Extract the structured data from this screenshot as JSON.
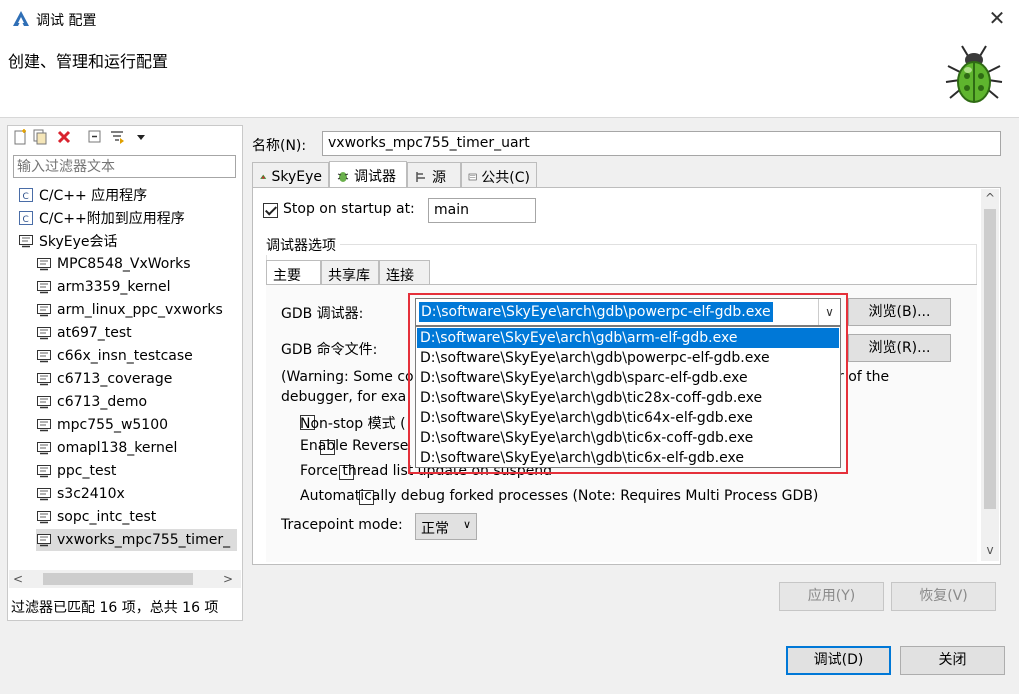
{
  "window": {
    "title": "调试 配置",
    "close_glyph": "✕"
  },
  "banner": {
    "title": "创建、管理和运行配置"
  },
  "left": {
    "filter_placeholder": "输入过滤器文本",
    "tree": [
      {
        "label": "C/C++ 应用程序",
        "level": 0,
        "icon": "c-app-icon"
      },
      {
        "label": "C/C++附加到应用程序",
        "level": 0,
        "icon": "c-attach-icon"
      },
      {
        "label": "SkyEye会话",
        "level": 0,
        "icon": "skyeye-session-icon"
      },
      {
        "label": "MPC8548_VxWorks",
        "level": 1,
        "icon": "config-icon"
      },
      {
        "label": "arm3359_kernel",
        "level": 1,
        "icon": "config-icon"
      },
      {
        "label": "arm_linux_ppc_vxworks",
        "level": 1,
        "icon": "config-icon"
      },
      {
        "label": "at697_test",
        "level": 1,
        "icon": "config-icon"
      },
      {
        "label": "c66x_insn_testcase",
        "level": 1,
        "icon": "config-icon"
      },
      {
        "label": "c6713_coverage",
        "level": 1,
        "icon": "config-icon"
      },
      {
        "label": "c6713_demo",
        "level": 1,
        "icon": "config-icon"
      },
      {
        "label": "mpc755_w5100",
        "level": 1,
        "icon": "config-icon"
      },
      {
        "label": "omapl138_kernel",
        "level": 1,
        "icon": "config-icon"
      },
      {
        "label": "ppc_test",
        "level": 1,
        "icon": "config-icon"
      },
      {
        "label": "s3c2410x",
        "level": 1,
        "icon": "config-icon"
      },
      {
        "label": "sopc_intc_test",
        "level": 1,
        "icon": "config-icon"
      },
      {
        "label": "vxworks_mpc755_timer_",
        "level": 1,
        "icon": "config-icon",
        "selected": true
      }
    ],
    "status": "过滤器已匹配 16 项，总共 16 项"
  },
  "right": {
    "name_label": "名称(N):",
    "name_value": "vxworks_mpc755_timer_uart",
    "tabs": [
      {
        "label": "SkyEye",
        "icon": "skyeye-tab-icon"
      },
      {
        "label": "调试器",
        "icon": "debugger-tab-icon",
        "active": true
      },
      {
        "label": "源",
        "icon": "source-tab-icon"
      },
      {
        "label": "公共(C)",
        "icon": "common-tab-icon"
      }
    ],
    "stop_on_startup_label": "Stop on startup at:",
    "stop_on_startup_value": "main",
    "group_title": "调试器选项",
    "subtabs": [
      "主要",
      "共享库",
      "连接"
    ],
    "gdb_debugger_label": "GDB 调试器:",
    "gdb_debugger_value": "D:\\software\\SkyEye\\arch\\gdb\\powerpc-elf-gdb.exe",
    "gdb_browse_label": "浏览(B)...",
    "gdb_cmd_label": "GDB 命令文件:",
    "gdb_cmd_browse_label": "浏览(R)...",
    "warning_line1_start": "(Warning: Some co",
    "warning_line1_end": "r of the",
    "warning_line2_start": "debugger, for exa",
    "nonstop_label": "Non-stop 模式 (",
    "reverse_label": "Enable Reverse",
    "force_thread_label": "Force thread list update on suspend",
    "auto_fork_label": "Automatically debug forked processes (Note: Requires Multi Process GDB)",
    "tracepoint_label": "Tracepoint mode:",
    "tracepoint_value": "正常",
    "dropdown_options": [
      "D:\\software\\SkyEye\\arch\\gdb\\arm-elf-gdb.exe",
      "D:\\software\\SkyEye\\arch\\gdb\\powerpc-elf-gdb.exe",
      "D:\\software\\SkyEye\\arch\\gdb\\sparc-elf-gdb.exe",
      "D:\\software\\SkyEye\\arch\\gdb\\tic28x-coff-gdb.exe",
      "D:\\software\\SkyEye\\arch\\gdb\\tic64x-elf-gdb.exe",
      "D:\\software\\SkyEye\\arch\\gdb\\tic6x-coff-gdb.exe",
      "D:\\software\\SkyEye\\arch\\gdb\\tic6x-elf-gdb.exe"
    ],
    "apply_label": "应用(Y)",
    "revert_label": "恢复(V)"
  },
  "footer": {
    "debug_label": "调试(D)",
    "close_label": "关闭"
  },
  "colors": {
    "accent": "#0078d7",
    "highlight_border": "#e5303a"
  }
}
